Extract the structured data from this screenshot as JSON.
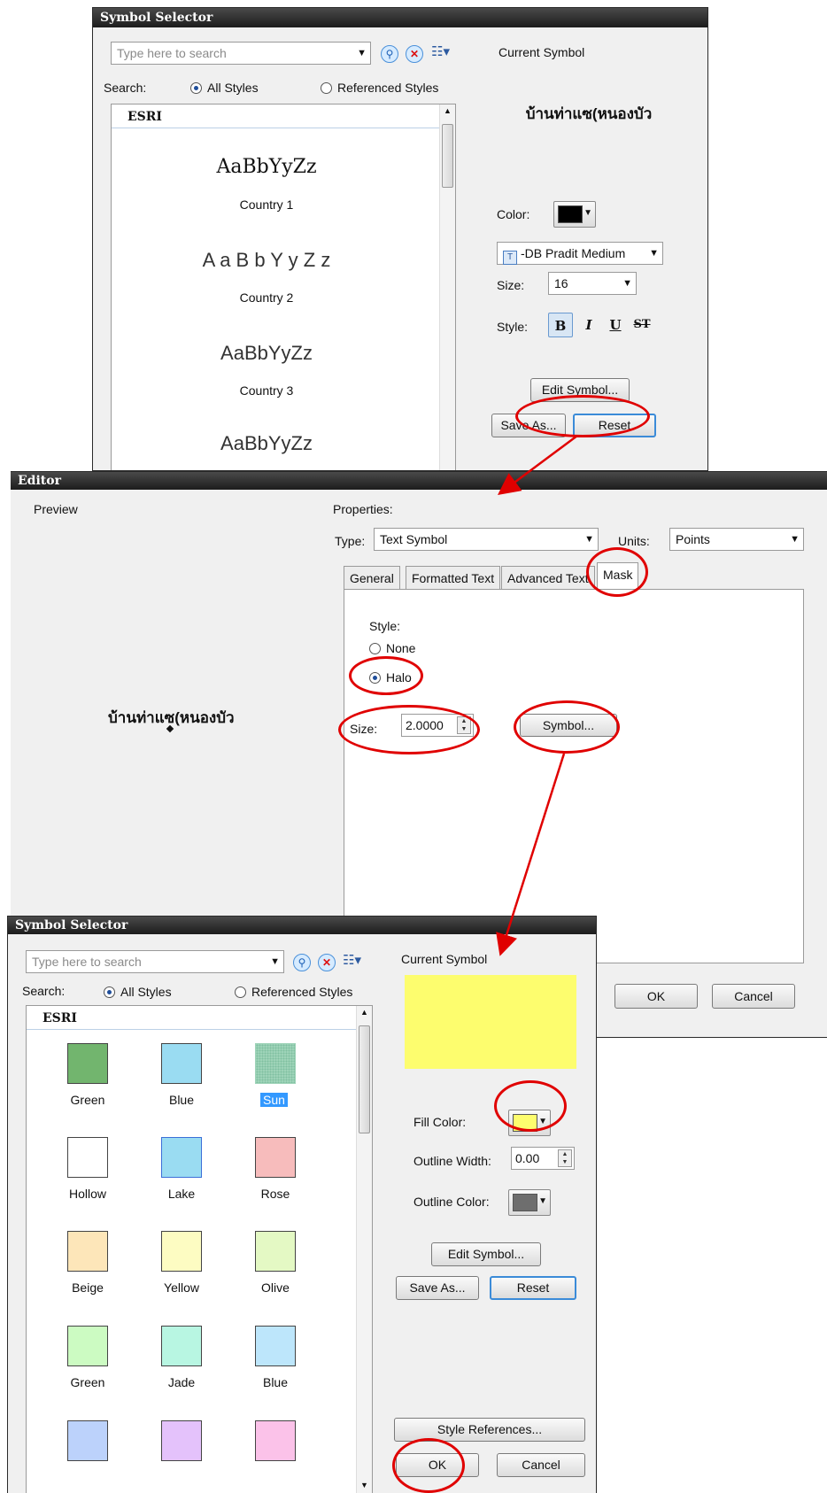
{
  "top_selector": {
    "title": "Symbol Selector",
    "search_placeholder": "Type here to search",
    "search_label": "Search:",
    "all_styles": "All Styles",
    "referenced_styles": "Referenced Styles",
    "list_header": "ESRI",
    "samples": [
      {
        "preview": "AaBbYyZz",
        "name": "Country 1"
      },
      {
        "preview": "A a B b Y y Z z",
        "name": "Country 2"
      },
      {
        "preview": "AaBbYyZz",
        "name": "Country 3"
      },
      {
        "preview": "AaBbYyZz",
        "name": ""
      }
    ],
    "current_symbol_label": "Current Symbol",
    "current_symbol_text": "บ้านท่าแซ(หนองบัว",
    "color_label": "Color:",
    "font_value": "-DB Pradit Medium",
    "size_label": "Size:",
    "size_value": "16",
    "style_label": "Style:",
    "style_buttons": [
      "B",
      "I",
      "U",
      "ST"
    ],
    "edit_symbol": "Edit Symbol...",
    "save_as": "Save As...",
    "reset": "Reset",
    "color_value": "#000000"
  },
  "editor": {
    "title": "Editor",
    "preview_label": "Preview",
    "preview_text": "บ้านท่าแซ(หนองบัว",
    "properties_label": "Properties:",
    "type_label": "Type:",
    "type_value": "Text Symbol",
    "units_label": "Units:",
    "units_value": "Points",
    "tabs": [
      "General",
      "Formatted Text",
      "Advanced Text",
      "Mask"
    ],
    "active_tab": "Mask",
    "style_label": "Style:",
    "none_label": "None",
    "halo_label": "Halo",
    "size_label": "Size:",
    "size_value": "2.0000",
    "symbol_button": "Symbol...",
    "ok": "OK",
    "cancel": "Cancel"
  },
  "bottom_selector": {
    "title": "Symbol Selector",
    "search_placeholder": "Type here to search",
    "search_label": "Search:",
    "all_styles": "All Styles",
    "referenced_styles": "Referenced Styles",
    "list_header": "ESRI",
    "swatches": [
      {
        "name": "Green",
        "color": "#72b56e"
      },
      {
        "name": "Blue",
        "color": "#9adcf2"
      },
      {
        "name": "Sun",
        "color": "#9ed3b8",
        "selected": true
      },
      {
        "name": "Hollow",
        "color": "#ffffff"
      },
      {
        "name": "Lake",
        "color": "#9adcf2"
      },
      {
        "name": "Rose",
        "color": "#f7bcbc"
      },
      {
        "name": "Beige",
        "color": "#fde6b9"
      },
      {
        "name": "Yellow",
        "color": "#fdfcc2"
      },
      {
        "name": "Olive",
        "color": "#e4f9c4"
      },
      {
        "name": "Green",
        "color": "#ccfbc2"
      },
      {
        "name": "Jade",
        "color": "#b8f6e2"
      },
      {
        "name": "Blue",
        "color": "#bde6fb"
      },
      {
        "name": "",
        "color": "#bcd2fb"
      },
      {
        "name": "",
        "color": "#e4c2fb"
      },
      {
        "name": "",
        "color": "#fbc2e9"
      }
    ],
    "current_symbol_label": "Current Symbol",
    "current_symbol_color": "#fdfd6e",
    "fill_color_label": "Fill Color:",
    "fill_color_value": "#fdfd6e",
    "outline_width_label": "Outline Width:",
    "outline_width_value": "0.00",
    "outline_color_label": "Outline Color:",
    "outline_color_value": "#6e6e6e",
    "edit_symbol": "Edit Symbol...",
    "save_as": "Save As...",
    "reset": "Reset",
    "style_references": "Style References...",
    "ok": "OK",
    "cancel": "Cancel"
  },
  "colors": {
    "annotation": "#e00000",
    "titlebar": "#1c1c1c",
    "selected_highlight": "#3399ff"
  }
}
